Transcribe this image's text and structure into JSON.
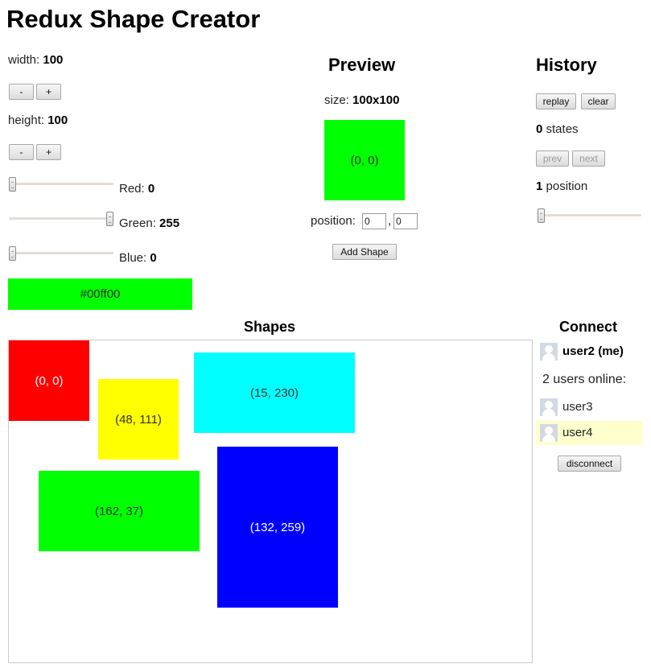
{
  "app": {
    "title": "Redux Shape Creator"
  },
  "controls": {
    "width_label": "width:",
    "width_value": "100",
    "height_label": "height:",
    "height_value": "100",
    "decrement_label": "-",
    "increment_label": "+",
    "red_label": "Red:",
    "red_value": "0",
    "green_label": "Green:",
    "green_value": "255",
    "blue_label": "Blue:",
    "blue_value": "0",
    "color_hex": "#00ff00",
    "slider_fractions": {
      "red": 0,
      "green": 1,
      "blue": 0
    }
  },
  "preview": {
    "heading": "Preview",
    "size_label": "size:",
    "size_value": "100x100",
    "box_text": "(0, 0)",
    "box_color": "#00ff00",
    "position_label": "position:",
    "position_x": "0",
    "position_sep": ",",
    "position_y": "0",
    "add_button": "Add Shape"
  },
  "history": {
    "heading": "History",
    "replay": "replay",
    "clear": "clear",
    "states_count": "0",
    "states_label": "states",
    "prev": "prev",
    "next": "next",
    "position_value": "1",
    "position_label": "position",
    "slider_fraction": 0
  },
  "shapes": {
    "heading": "Shapes",
    "items": [
      {
        "text": "(0, 0)",
        "color": "#ff0000",
        "text_color": "#ffffff"
      },
      {
        "text": "(48, 111)",
        "color": "#ffff00",
        "text_color": "#333333"
      },
      {
        "text": "(15, 230)",
        "color": "#00ffff",
        "text_color": "#333333"
      },
      {
        "text": "(162, 37)",
        "color": "#00ff00",
        "text_color": "#333333"
      },
      {
        "text": "(132, 259)",
        "color": "#0000ff",
        "text_color": "#ffffff"
      }
    ]
  },
  "connect": {
    "heading": "Connect",
    "me": "user2 (me)",
    "online_text": "2 users online:",
    "users": [
      {
        "name": "user3"
      },
      {
        "name": "user4"
      }
    ],
    "disconnect": "disconnect",
    "highlight_color": "#ffffcc"
  }
}
